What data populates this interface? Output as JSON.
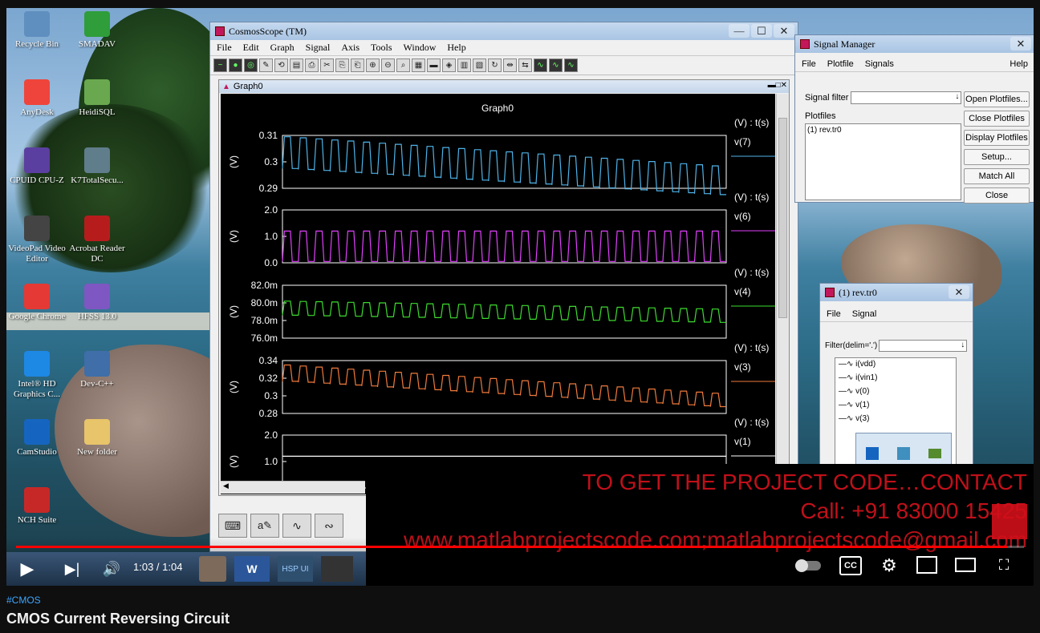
{
  "desktop": {
    "icons": [
      {
        "label": "Recycle Bin",
        "icon": "recycle-bin-icon",
        "color": "#5f8fbf"
      },
      {
        "label": "SMADAV",
        "icon": "smadav-icon",
        "color": "#2e9d3a"
      },
      {
        "label": "AnyDesk",
        "icon": "anydesk-icon",
        "color": "#ef443b"
      },
      {
        "label": "HeidiSQL",
        "icon": "heidisql-icon",
        "color": "#6aa84f"
      },
      {
        "label": "CPUID CPU-Z",
        "icon": "cpuz-icon",
        "color": "#5b3fa0"
      },
      {
        "label": "K7TotalSecu...",
        "icon": "k7-icon",
        "color": "#607d8b"
      },
      {
        "label": "VideoPad Video Editor",
        "icon": "videopad-icon",
        "color": "#444444"
      },
      {
        "label": "Acrobat Reader DC",
        "icon": "acrobat-icon",
        "color": "#b71c1c"
      },
      {
        "label": "Google Chrome",
        "icon": "chrome-icon",
        "color": "#e53935"
      },
      {
        "label": "HFSS 13.0",
        "icon": "hfss-icon",
        "color": "#7e57c2"
      },
      {
        "label": "Intel® HD Graphics C...",
        "icon": "intel-graphics-icon",
        "color": "#1e88e5"
      },
      {
        "label": "Dev-C++",
        "icon": "devcpp-icon",
        "color": "#3f6ea8"
      },
      {
        "label": "CamStudio",
        "icon": "camstudio-icon",
        "color": "#1565c0"
      },
      {
        "label": "New folder",
        "icon": "folder-icon",
        "color": "#e8c46a"
      },
      {
        "label": "NCH Suite",
        "icon": "nch-icon",
        "color": "#c62828"
      }
    ]
  },
  "cosmos": {
    "title": "CosmosScope (TM)",
    "menu": [
      "File",
      "Edit",
      "Graph",
      "Signal",
      "Axis",
      "Tools",
      "Window",
      "Help"
    ],
    "graph_window_title": "Graph0",
    "graph_title": "Graph0",
    "x_label": "(V) : t(s)"
  },
  "chart_data": {
    "type": "line",
    "title": "Graph0",
    "panels": [
      {
        "signal": "v(7)",
        "ylabel": "(V)",
        "ticks": [
          "0.31",
          "0.3",
          "0.29"
        ],
        "ylim": [
          0.29,
          0.31
        ],
        "color": "#4fb3e8",
        "low": 0.2975,
        "high": 0.3095,
        "high_end": 0.2985,
        "cycles": 28
      },
      {
        "signal": "v(6)",
        "ylabel": "(V)",
        "ticks": [
          "2.0",
          "1.0",
          "0.0"
        ],
        "ylim": [
          0.0,
          2.0
        ],
        "color": "#e040fb",
        "low": 0.05,
        "high": 1.2,
        "high_end": 1.2,
        "cycles": 28
      },
      {
        "signal": "v(4)",
        "ylabel": "(V)",
        "ticks": [
          "82.0m",
          "80.0m",
          "78.0m",
          "76.0m"
        ],
        "ylim": [
          0.076,
          0.082
        ],
        "color": "#3ddc2f",
        "low": 0.0786,
        "high": 0.0802,
        "high_end": 0.0793,
        "cycles": 28
      },
      {
        "signal": "v(3)",
        "ylabel": "(V)",
        "ticks": [
          "0.34",
          "0.32",
          "0.3",
          "0.28"
        ],
        "ylim": [
          0.28,
          0.34
        ],
        "color": "#f07a3c",
        "low": 0.3165,
        "high": 0.335,
        "high_end": 0.303,
        "cycles": 28
      },
      {
        "signal": "v(1)",
        "ylabel": "(V)",
        "ticks": [
          "2.0",
          "1.0"
        ],
        "ylim": [
          0.0,
          2.0
        ],
        "color": "#ffffff",
        "low": 1.2,
        "high": 1.2,
        "high_end": 1.2,
        "cycles": 0
      }
    ]
  },
  "signal_manager": {
    "title": "Signal Manager",
    "menu": [
      "File",
      "Plotfile",
      "Signals"
    ],
    "help": "Help",
    "filter_label": "Signal filter",
    "plotfiles_label": "Plotfiles",
    "plotfile_item": "(1) rev.tr0",
    "buttons": [
      "Open Plotfiles...",
      "Close Plotfiles",
      "Display Plotfiles",
      "Setup...",
      "Match All",
      "Close"
    ]
  },
  "rev_window": {
    "title": "(1) rev.tr0",
    "menu": [
      "File",
      "Signal"
    ],
    "filter_label": "Filter(delim='.')",
    "signals": [
      "i(vdd)",
      "i(vin1)",
      "v(0)",
      "v(1)",
      "v(3)"
    ]
  },
  "promo": {
    "line1": "TO GET THE PROJECT CODE…CONTACT",
    "line2": "Call: +91 83000 15425",
    "line3": "www.matlabprojectscode.com;matlabprojectscode@gmail.com",
    "color": "#c0101a"
  },
  "player": {
    "time": "1:03 / 1:04",
    "progress": 0.984,
    "accent": "#ff0000"
  },
  "video": {
    "hashtag": "#CMOS",
    "title": "CMOS Current Reversing Circuit"
  }
}
